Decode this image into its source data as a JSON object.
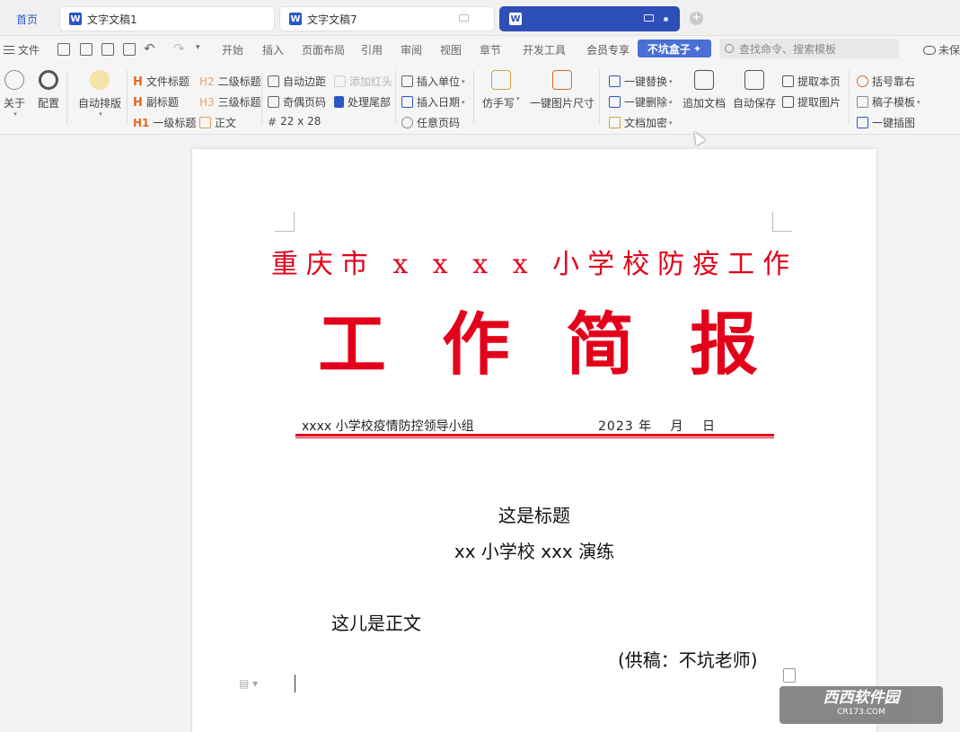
{
  "tabs": {
    "home": "首页",
    "doc1": "文字文稿1",
    "doc7": "文字文稿7",
    "active": "",
    "add": "+"
  },
  "menu": {
    "file": "文件",
    "items": [
      "开始",
      "插入",
      "页面布局",
      "引用",
      "审阅",
      "视图",
      "章节",
      "开发工具",
      "会员专享"
    ],
    "plugin": "不坑盒子",
    "search_placeholder": "查找命令、搜索模板",
    "cloud": "未保"
  },
  "ribbon": {
    "about": "关于",
    "config": "配置",
    "auto_layout": "自动排版",
    "doc_title": "文件标题",
    "sub_title": "副标题",
    "h1": "一级标题",
    "h2": "二级标题",
    "h3": "三级标题",
    "body": "正文",
    "auto_margin": "自动边距",
    "odd_even": "奇偶页码",
    "grid": "22 x 28",
    "red_head": "添加红头",
    "tail": "处理尾部",
    "insert_unit": "插入单位",
    "insert_date": "插入日期",
    "any_page": "任意页码",
    "imitate": "仿手写",
    "img_size": "一键图片尺寸",
    "replace": "一键替换",
    "delete": "一键删除",
    "encrypt": "文档加密",
    "append_doc": "追加文档",
    "auto_save": "自动保存",
    "extract_page": "提取本页",
    "extract_img": "提取图片",
    "bracket_right": "括号靠右",
    "template": "稿子模板",
    "insert_chart": "一键插图"
  },
  "doc": {
    "title_line1": "重庆市 x x x x 小学校防疫工作",
    "title_line2": [
      "工",
      "作",
      "简",
      "报"
    ],
    "org": "xxxx 小学校疫情防控领导小组",
    "date": "2023 年　 月　 日",
    "heading1": "这是标题",
    "heading2": "xx 小学校 xxx 演练",
    "body": "这儿是正文",
    "credit": "(供稿：不坑老师)"
  },
  "watermark": {
    "brand": "西西软件园",
    "url": "CR173.COM"
  },
  "colors": {
    "accent": "#2f4fb8",
    "red": "#e3001b"
  }
}
